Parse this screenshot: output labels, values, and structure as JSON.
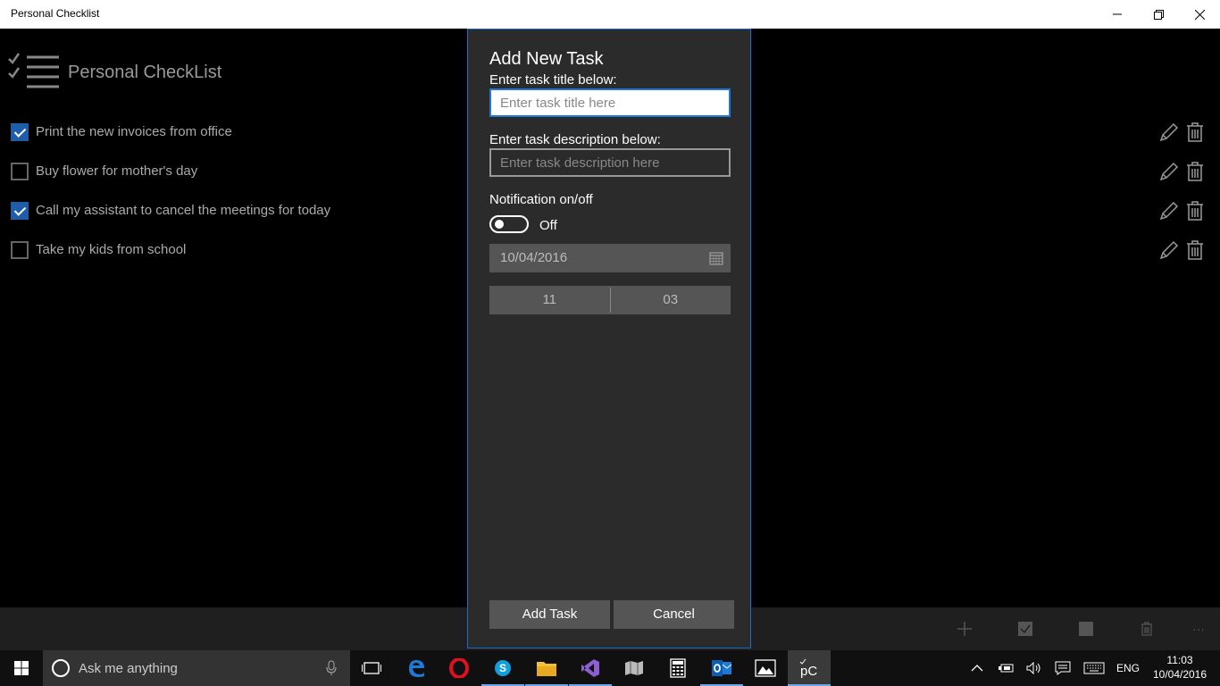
{
  "window": {
    "title": "Personal Checklist"
  },
  "app": {
    "title": "Personal CheckList",
    "tasks": [
      {
        "label": "Print the new invoices from office",
        "checked": true
      },
      {
        "label": "Buy flower for mother's day",
        "checked": false
      },
      {
        "label": "Call my assistant to cancel the meetings for today",
        "checked": true
      },
      {
        "label": "Take my kids from school",
        "checked": false
      }
    ]
  },
  "dialog": {
    "title": "Add New Task",
    "title_label": "Enter task title below:",
    "title_placeholder": "Enter task title here",
    "title_value": "",
    "desc_label": "Enter task description below:",
    "desc_placeholder": "Enter task description here",
    "desc_value": "",
    "notification_label": "Notification on/off",
    "toggle_state": "Off",
    "date": "10/04/2016",
    "hour": "11",
    "minute": "03",
    "add_button": "Add Task",
    "cancel_button": "Cancel"
  },
  "commandbar": {
    "icons": [
      "add-icon",
      "check-all-icon",
      "uncheck-all-icon",
      "delete-icon",
      "more-icon"
    ],
    "more_label": "···"
  },
  "taskbar": {
    "search_placeholder": "Ask me anything",
    "apps": [
      "task-view",
      "edge",
      "opera",
      "skype",
      "file-explorer",
      "visual-studio",
      "maps",
      "calculator",
      "outlook",
      "photos",
      "personal-checklist"
    ],
    "language": "ENG",
    "time": "11:03",
    "date": "10/04/2016"
  },
  "colors": {
    "accent": "#1e6cc4",
    "checkbox_on": "#1f5da8",
    "dialog_bg": "#2b2b2b",
    "taskbar_bg": "#101010"
  }
}
